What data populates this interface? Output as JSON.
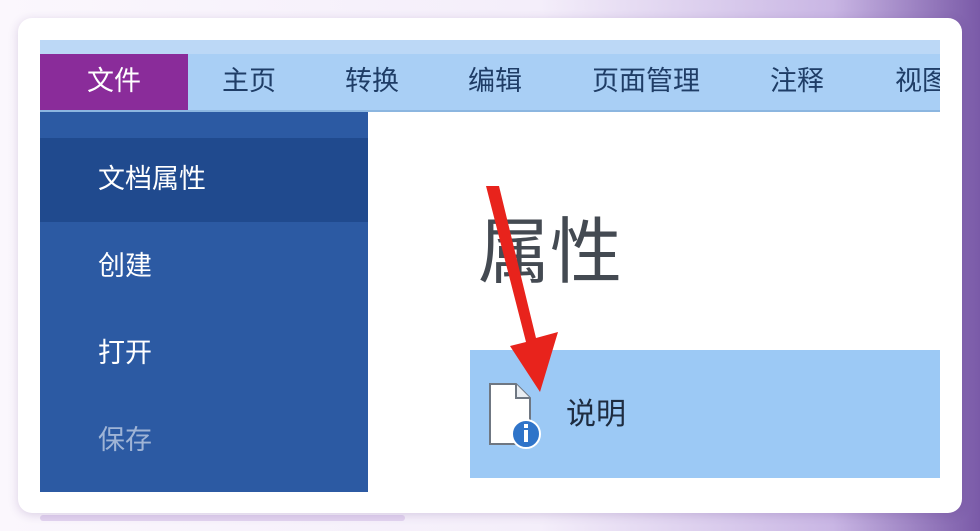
{
  "ribbon": {
    "tabs": [
      {
        "label": "文件"
      },
      {
        "label": "主页"
      },
      {
        "label": "转换"
      },
      {
        "label": "编辑"
      },
      {
        "label": "页面管理"
      },
      {
        "label": "注释"
      },
      {
        "label": "视图"
      }
    ]
  },
  "sidebar": {
    "items": [
      {
        "label": "文档属性",
        "state": "active"
      },
      {
        "label": "创建"
      },
      {
        "label": "打开"
      },
      {
        "label": "保存",
        "state": "disabled"
      }
    ]
  },
  "main": {
    "heading": "属性",
    "info_row": {
      "label": "说明",
      "icon": "document-info-icon"
    }
  },
  "annotation": {
    "icon": "red-arrow-icon",
    "color": "#e8231c"
  },
  "colors": {
    "file_tab": "#8a2c9a",
    "sidebar": "#2c5aa3",
    "sidebar_active": "#204a8e",
    "ribbon": "#a9cff5",
    "info_row": "#9cc9f5"
  }
}
